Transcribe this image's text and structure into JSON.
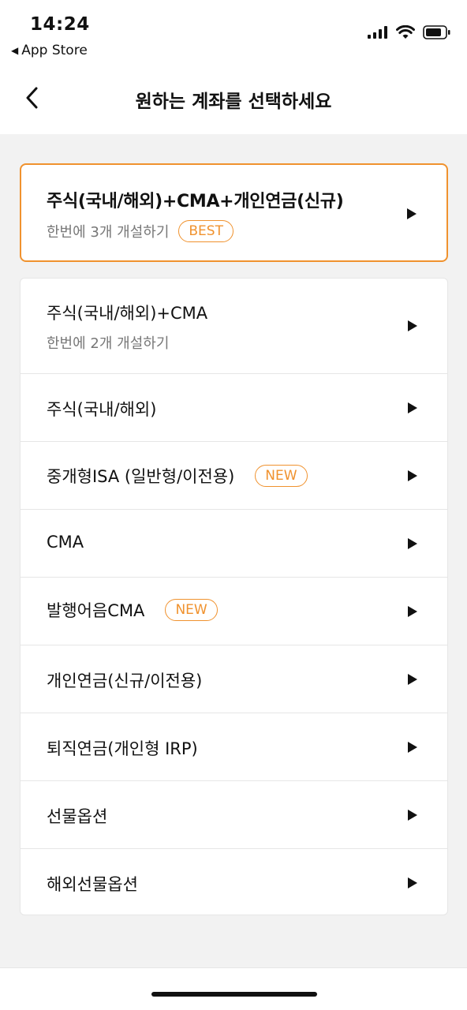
{
  "status": {
    "time": "14:24",
    "back_label": "App Store"
  },
  "nav": {
    "title": "원하는 계좌를 선택하세요"
  },
  "featured": {
    "title": "주식(국내/해외)+CMA+개인연금(신규)",
    "subtitle": "한번에 3개 개설하기",
    "badge": "BEST"
  },
  "items": [
    {
      "label": "주식(국내/해외)+CMA",
      "subtitle": "한번에 2개 개설하기"
    },
    {
      "label": "주식(국내/해외)"
    },
    {
      "label": "중개형ISA (일반형/이전용)",
      "badge": "NEW"
    },
    {
      "label": "CMA"
    },
    {
      "label": "발행어음CMA",
      "badge": "NEW"
    },
    {
      "label": "개인연금(신규/이전용)"
    },
    {
      "label": "퇴직연금(개인형 IRP)"
    },
    {
      "label": "선물옵션"
    },
    {
      "label": "해외선물옵션"
    }
  ],
  "colors": {
    "accent": "#f0922e",
    "background": "#f2f2f2",
    "text": "#111111"
  },
  "icons": {
    "back": "chevron-left-icon",
    "arrow": "play-triangle-icon"
  }
}
